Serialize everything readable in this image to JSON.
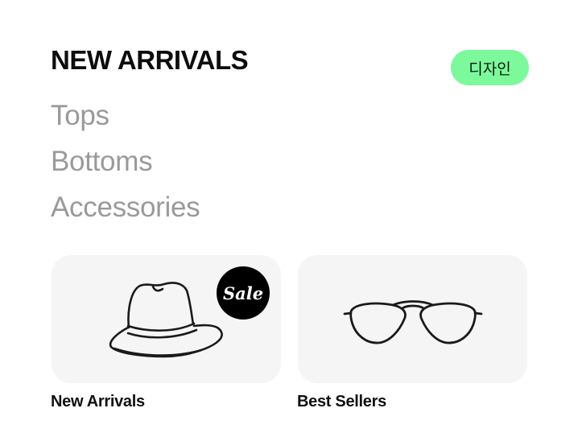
{
  "header": {
    "title": "NEW ARRIVALS",
    "badge_label": "디자인",
    "badge_color": "#7CF99A"
  },
  "categories": [
    {
      "label": "Tops"
    },
    {
      "label": "Bottoms"
    },
    {
      "label": "Accessories"
    }
  ],
  "cards": [
    {
      "label": "New Arrivals",
      "icon": "hat-icon",
      "sale_badge": "Sale"
    },
    {
      "label": "Best Sellers",
      "icon": "sunglasses-icon"
    }
  ],
  "colors": {
    "card_background": "#F5F5F5",
    "category_text": "#9A9A9A",
    "sale_badge_background": "#000000"
  }
}
